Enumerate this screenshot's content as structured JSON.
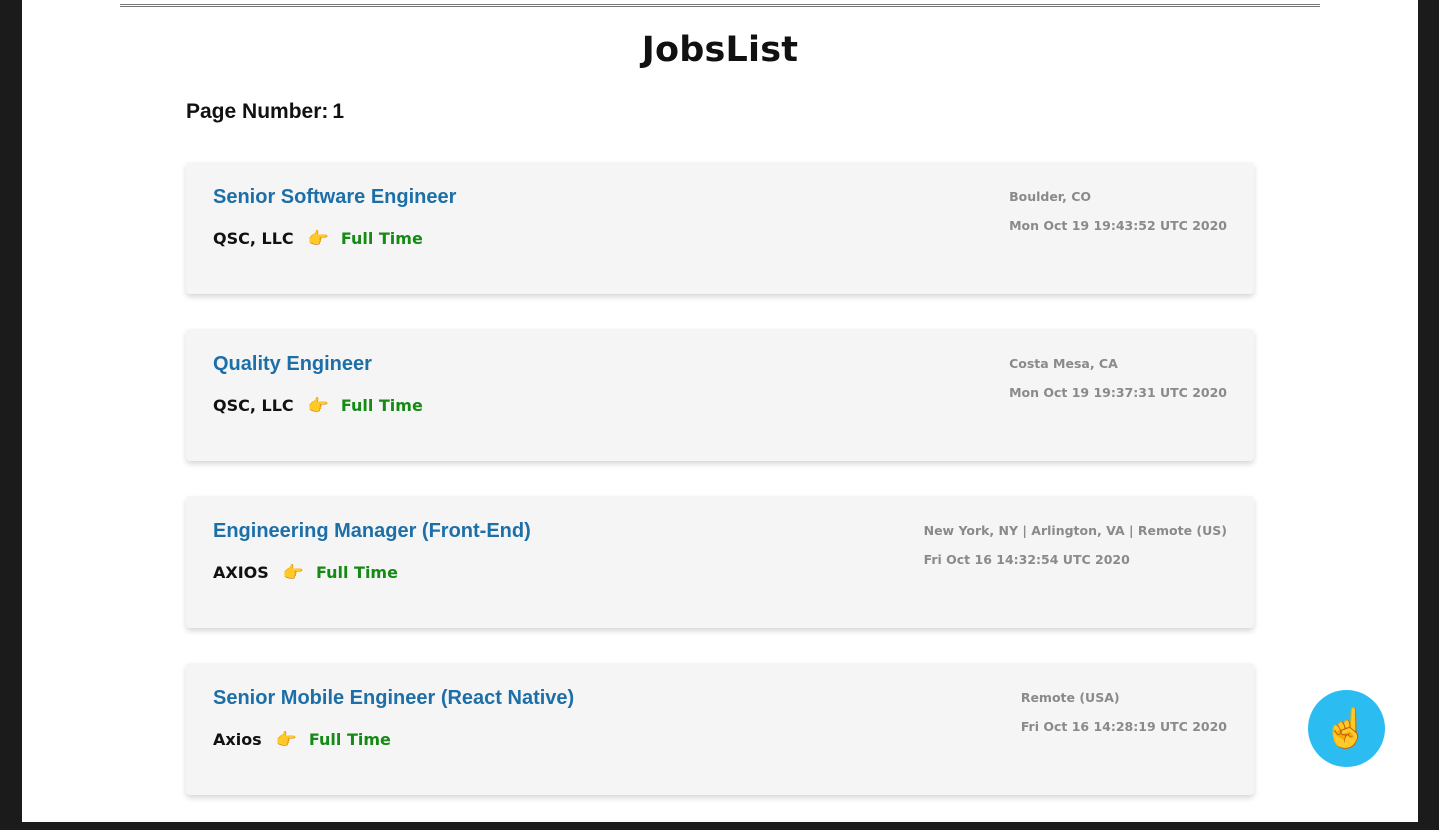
{
  "header": {
    "title": "JobsList",
    "page_number_label": "Page Number:",
    "page_number": "1"
  },
  "jobs": [
    {
      "title": "Senior Software Engineer",
      "company": "QSC, LLC",
      "pointer_icon": "👉",
      "type": "Full Time",
      "location": "Boulder, CO",
      "date": "Mon Oct 19 19:43:52 UTC 2020"
    },
    {
      "title": "Quality Engineer",
      "company": "QSC, LLC",
      "pointer_icon": "👉",
      "type": "Full Time",
      "location": "Costa Mesa, CA",
      "date": "Mon Oct 19 19:37:31 UTC 2020"
    },
    {
      "title": "Engineering Manager (Front-End)",
      "company": "AXIOS",
      "pointer_icon": "👉",
      "type": "Full Time",
      "location": "New York, NY | Arlington, VA | Remote (US)",
      "date": "Fri Oct 16 14:32:54 UTC 2020"
    },
    {
      "title": "Senior Mobile Engineer (React Native)",
      "company": "Axios",
      "pointer_icon": "👉",
      "type": "Full Time",
      "location": "Remote (USA)",
      "date": "Fri Oct 16 14:28:19 UTC 2020"
    }
  ],
  "scroll_top_button": {
    "icon": "☝️",
    "icon_name": "pointing-up-icon",
    "color": "#2bbcf2"
  },
  "colors": {
    "job_title": "#1d6fa8",
    "job_type": "#158a15",
    "meta_text": "#8a8a8a",
    "card_bg": "#f5f5f5"
  }
}
